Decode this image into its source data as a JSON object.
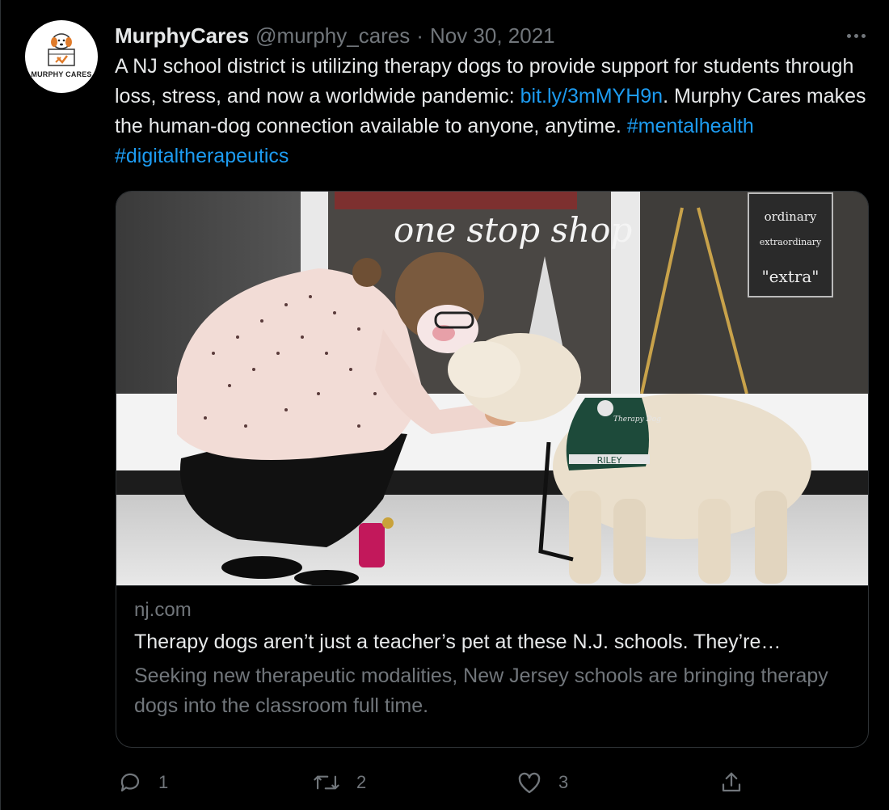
{
  "tweet": {
    "author_name": "MurphyCares",
    "handle": "@murphy_cares",
    "separator": "·",
    "date": "Nov 30, 2021",
    "avatar_text": "MURPHY CARES",
    "text_part1": "A NJ school district is utilizing therapy dogs to provide support for students through loss, stress, and now a worldwide pandemic: ",
    "link": "bit.ly/3mMYH9n",
    "text_part2": ". Murphy Cares makes the human-dog connection available to anyone, anytime. ",
    "hashtag1": "#mentalhealth",
    "hashtag2": "#digitaltherapeutics"
  },
  "card": {
    "domain": "nj.com",
    "title": "Therapy dogs aren’t just a teacher’s pet at these N.J. schools. They’re…",
    "description": "Seeking new therapeutic modalities, New Jersey schools are bringing therapy dogs into the classroom full time.",
    "image_texts": {
      "window_sign": "one stop shop",
      "poster_line1": "ordinary",
      "poster_line2": "extraordinary",
      "poster_line3": "\"extra\"",
      "vest_label": "RILEY",
      "vest_patch": "Therapy Dog"
    }
  },
  "actions": {
    "replies": "1",
    "retweets": "2",
    "likes": "3"
  },
  "colors": {
    "background": "#000000",
    "text": "#e7e9ea",
    "muted": "#71767b",
    "link": "#1d9bf0",
    "border": "#2f3336"
  },
  "icons": [
    "more-icon",
    "reply-icon",
    "retweet-icon",
    "like-icon",
    "share-icon"
  ]
}
